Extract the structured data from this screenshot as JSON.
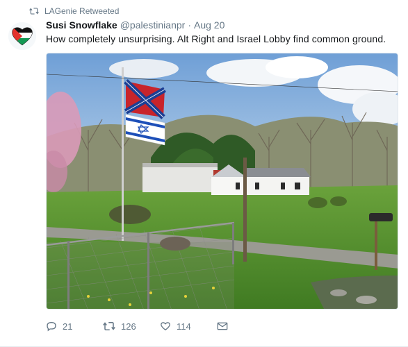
{
  "retweet_context": {
    "icon": "retweet-icon",
    "text": "LAGenie Retweeted"
  },
  "tweet": {
    "author_name": "Susi Snowflake",
    "handle": "@palestinianpr",
    "separator": "·",
    "time": "Aug 20",
    "text": "How completely unsurprising. Alt Right and Israel Lobby find common ground.",
    "avatar": "palestinian-flag-heart-avatar",
    "media": "photo of a flagpole flying a Confederate flag above an Israeli flag in front of a rural house"
  },
  "actions": {
    "reply": {
      "icon": "reply-icon",
      "count": "21"
    },
    "retweet": {
      "icon": "retweet-icon",
      "count": "126"
    },
    "like": {
      "icon": "heart-icon",
      "count": "114"
    },
    "dm": {
      "icon": "envelope-icon"
    }
  },
  "colors": {
    "secondary_text": "#657786",
    "primary_text": "#14171a",
    "border": "#e1e8ed"
  }
}
